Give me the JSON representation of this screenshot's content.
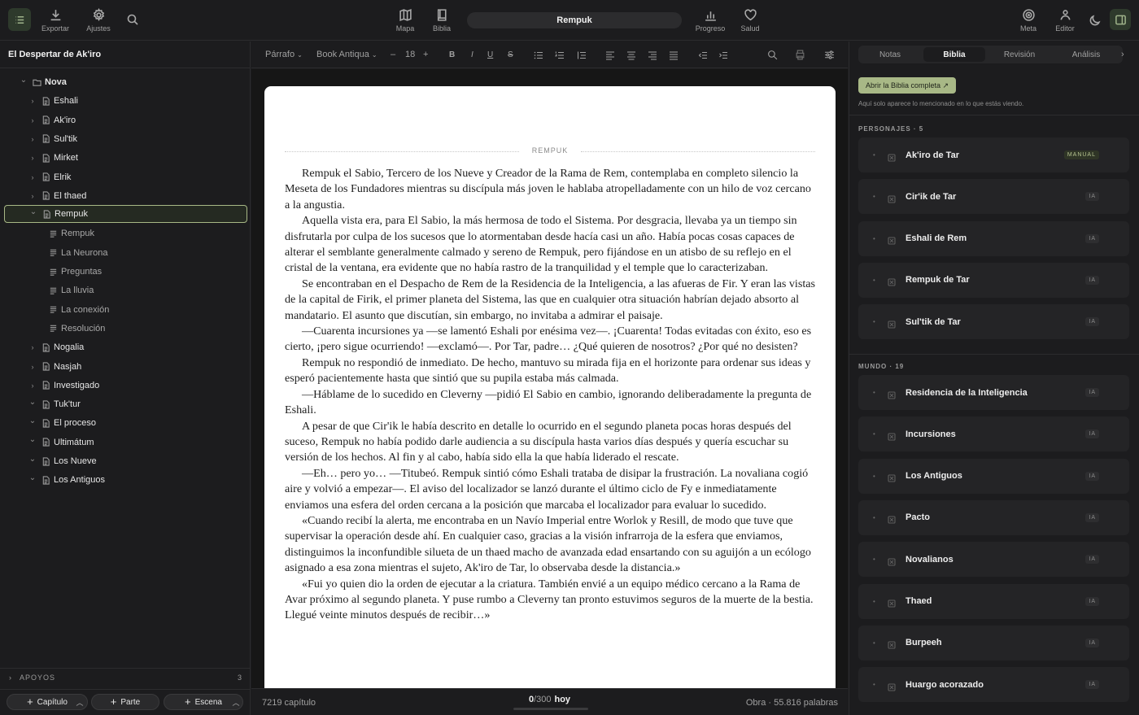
{
  "topbar": {
    "export_label": "Exportar",
    "settings_label": "Ajustes",
    "map_label": "Mapa",
    "bible_label": "Biblia",
    "doc_title": "Rempuk",
    "progress_label": "Progreso",
    "health_label": "Salud",
    "goal_label": "Meta",
    "editor_label": "Editor"
  },
  "sidebar": {
    "project_title": "El Despertar de Ak'iro",
    "tree": [
      {
        "label": "Nova",
        "level": 0,
        "expanded": true,
        "kind": "folder",
        "bold": true
      },
      {
        "label": "Eshali",
        "level": 1,
        "expanded": false,
        "kind": "doc"
      },
      {
        "label": "Ak'iro",
        "level": 1,
        "expanded": false,
        "kind": "doc"
      },
      {
        "label": "Sul'tik",
        "level": 1,
        "expanded": false,
        "kind": "doc"
      },
      {
        "label": "Mirket",
        "level": 1,
        "expanded": false,
        "kind": "doc"
      },
      {
        "label": "Elrik",
        "level": 1,
        "expanded": false,
        "kind": "doc"
      },
      {
        "label": "El thaed",
        "level": 1,
        "expanded": false,
        "kind": "doc"
      },
      {
        "label": "Rempuk",
        "level": 1,
        "expanded": true,
        "kind": "doc",
        "selected": true
      },
      {
        "label": "Rempuk",
        "level": 2,
        "kind": "scene"
      },
      {
        "label": "La Neurona",
        "level": 2,
        "kind": "scene"
      },
      {
        "label": "Preguntas",
        "level": 2,
        "kind": "scene"
      },
      {
        "label": "La lluvia",
        "level": 2,
        "kind": "scene"
      },
      {
        "label": "La conexión",
        "level": 2,
        "kind": "scene"
      },
      {
        "label": "Resolución",
        "level": 2,
        "kind": "scene"
      },
      {
        "label": "Nogalia",
        "level": 1,
        "expanded": false,
        "kind": "doc"
      },
      {
        "label": "Nasjah",
        "level": 1,
        "expanded": false,
        "kind": "doc"
      },
      {
        "label": "Investigado",
        "level": 1,
        "expanded": false,
        "kind": "doc"
      },
      {
        "label": "Tuk'tur",
        "level": 1,
        "expanded": true,
        "kind": "doc"
      },
      {
        "label": "El proceso",
        "level": 1,
        "expanded": true,
        "kind": "doc"
      },
      {
        "label": "Ultimátum",
        "level": 1,
        "expanded": true,
        "kind": "doc"
      },
      {
        "label": "Los Nueve",
        "level": 1,
        "expanded": true,
        "kind": "doc"
      },
      {
        "label": "Los Antiguos",
        "level": 1,
        "expanded": true,
        "kind": "doc"
      }
    ],
    "apoyos_label": "APOYOS",
    "apoyos_count": "3",
    "add_chapter": "Capítulo",
    "add_part": "Parte",
    "add_scene": "Escena"
  },
  "toolbar": {
    "style_select": "Párrafo",
    "font_select": "Book Antiqua",
    "font_minus": "–",
    "font_size": "18",
    "font_plus": "+",
    "bold": "B",
    "italic": "I",
    "underline": "U",
    "strike": "S"
  },
  "editor": {
    "scene_label": "REMPUK",
    "paragraphs": [
      "Rempuk el Sabio, Tercero de los Nueve y Creador de la Rama de Rem, contemplaba en completo silencio la Meseta de los Fundadores mientras su discípula más joven le hablaba atropelladamente con un hilo de voz cercano a la angustia.",
      "Aquella vista era, para El Sabio, la más hermosa de todo el Sistema. Por desgracia, llevaba ya un tiempo sin disfrutarla por culpa de los sucesos que lo atormentaban desde hacía casi un año. Había pocas cosas capaces de alterar el semblante generalmente calmado y sereno de Rempuk, pero fijándose en un atisbo de su reflejo en el cristal de la ventana, era evidente que no había rastro de la tranquilidad y el temple que lo caracterizaban.",
      "Se encontraban en el Despacho de Rem de la Residencia de la Inteligencia, a las afueras de Fir. Y eran las vistas de la capital de Firik, el primer planeta del Sistema, las que en cualquier otra situación habrían dejado absorto al mandatario. El asunto que discutían, sin embargo, no invitaba a admirar el paisaje.",
      "—Cuarenta incursiones ya —se lamentó Eshali por enésima vez—. ¡Cuarenta! Todas evitadas con éxito, eso es cierto, ¡pero sigue ocurriendo! —exclamó—. Por Tar, padre… ¿Qué quieren de nosotros? ¿Por qué no desisten?",
      "Rempuk no respondió de inmediato. De hecho, mantuvo su mirada fija en el horizonte para ordenar sus ideas y esperó pacientemente hasta que sintió que su pupila estaba más calmada.",
      "—Háblame de lo sucedido en Cleverny —pidió El Sabio en cambio, ignorando deliberadamente la pregunta de Eshali.",
      "A pesar de que Cir'ik le había descrito en detalle lo ocurrido en el segundo planeta pocas horas después del suceso, Rempuk no había podido darle audiencia a su discípula hasta varios días después y quería escuchar su versión de los hechos. Al fin y al cabo, había sido ella la que había liderado el rescate.",
      "—Eh… pero yo… —Titubeó. Rempuk sintió cómo Eshali trataba de disipar la frustración. La novaliana cogió aire y volvió a empezar—. El aviso del localizador se lanzó durante el último ciclo de Fy e inmediatamente enviamos una esfera del orden cercana a la posición que marcaba el localizador para evaluar lo sucedido.",
      "«Cuando recibí la alerta, me encontraba en un Navío Imperial entre Worlok y Resill, de modo que tuve que supervisar la operación desde ahí. En cualquier caso, gracias a la visión infrarroja de la esfera que enviamos, distinguimos la inconfundible silueta de un thaed macho de avanzada edad ensartando con su aguijón a un ecólogo asignado a esa zona mientras el sujeto, Ak'iro de Tar, lo observaba desde la distancia.»",
      "«Fui yo quien dio la orden de ejecutar a la criatura. También envié a un equipo médico cercano a la Rama de Avar próximo al segundo planeta. Y puse rumbo a Cleverny tan pronto estuvimos seguros de la muerte de la bestia. Llegué veinte minutos después de recibir…»"
    ]
  },
  "status": {
    "chapter_words": "7219 capítulo",
    "goal_current": "0",
    "goal_total": "/300",
    "goal_period": "hoy",
    "goal_progress": 0,
    "total_words": "Obra · 55.816 palabras"
  },
  "rpanel": {
    "tabs": [
      "Notas",
      "Biblia",
      "Revisión",
      "Análisis"
    ],
    "active_tab": "Biblia",
    "open_bible_button": "Abrir la Biblia completa ↗",
    "hint": "Aquí solo aparece lo mencionado en lo que estás viendo.",
    "characters_header": "PERSONAJES · 5",
    "characters": [
      {
        "name": "Ak'iro de Tar",
        "badge": "MANUAL"
      },
      {
        "name": "Cir'ik de Tar",
        "badge": "IA"
      },
      {
        "name": "Eshali de Rem",
        "badge": "IA"
      },
      {
        "name": "Rempuk de Tar",
        "badge": "IA"
      },
      {
        "name": "Sul'tik de Tar",
        "badge": "IA"
      }
    ],
    "world_header": "MUNDO · 19",
    "world": [
      {
        "name": "Residencia de la Inteligencia",
        "badge": "IA"
      },
      {
        "name": "Incursiones",
        "badge": "IA"
      },
      {
        "name": "Los Antiguos",
        "badge": "IA"
      },
      {
        "name": "Pacto",
        "badge": "IA"
      },
      {
        "name": "Novalianos",
        "badge": "IA"
      },
      {
        "name": "Thaed",
        "badge": "IA"
      },
      {
        "name": "Burpeeh",
        "badge": "IA"
      },
      {
        "name": "Huargo acorazado",
        "badge": "IA"
      }
    ]
  },
  "colors": {
    "accent": "#a8b886",
    "page": "#ffffff",
    "background": "#1c1c1e"
  },
  "icons": [
    "list-icon",
    "download-icon",
    "gear-icon",
    "search-icon",
    "map-icon",
    "book-icon",
    "chart-icon",
    "heart-icon",
    "target-icon",
    "editor-icon",
    "moon-icon",
    "panel-icon"
  ]
}
